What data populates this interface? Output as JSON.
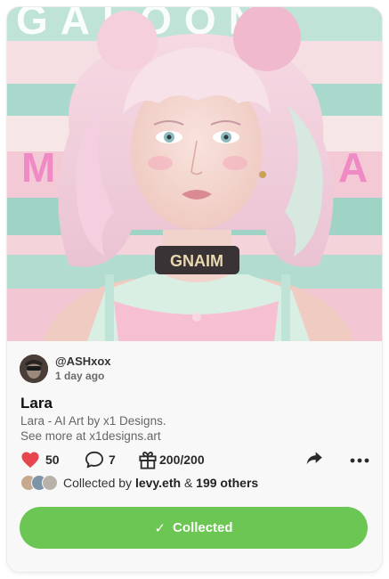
{
  "artwork": {
    "background_text_top": "GALOON",
    "background_text_left": "M",
    "background_text_right": "A",
    "choker_text": "GNAIM"
  },
  "author": {
    "handle": "@ASHxox",
    "posted": "1 day ago"
  },
  "post": {
    "title": "Lara",
    "description_line1": "Lara - AI Art by x1 Designs.",
    "description_line2": "See more at x1designs.art"
  },
  "stats": {
    "likes": "50",
    "comments": "7",
    "editions": "200/200"
  },
  "collectors": {
    "prefix": "Collected by",
    "first_collector": "levy.eth",
    "conjunction": "&",
    "others": "199 others"
  },
  "action": {
    "button_label": "Collected"
  },
  "colors": {
    "heart": "#e8464e",
    "button_green": "#6cc654"
  }
}
